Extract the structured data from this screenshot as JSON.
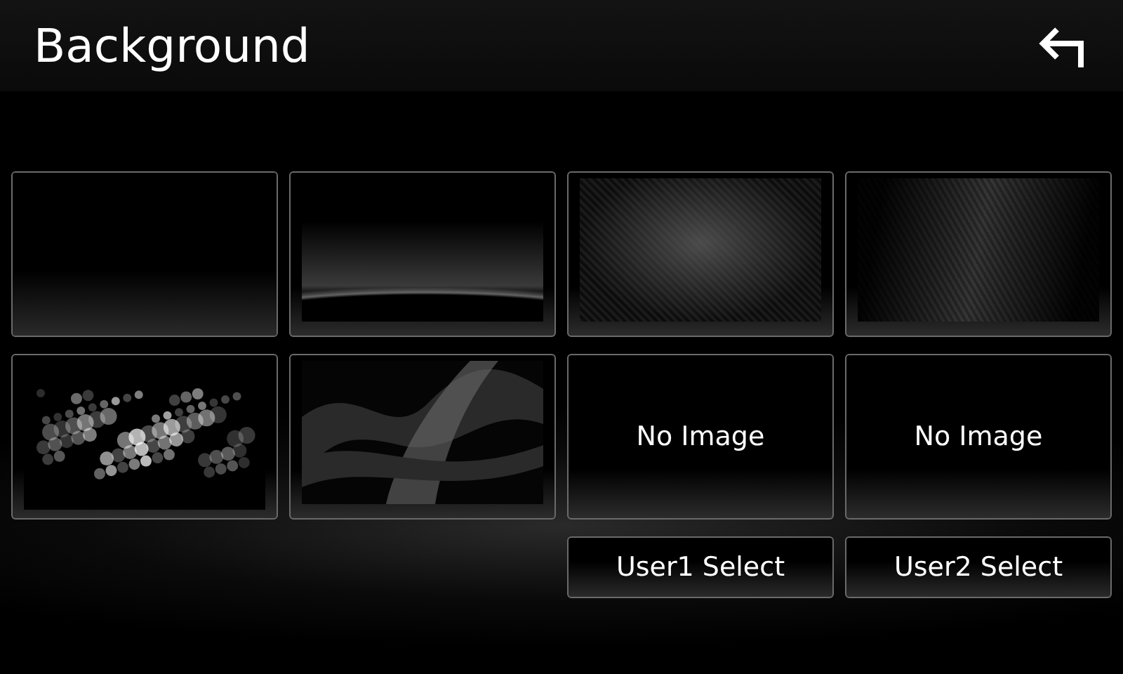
{
  "header": {
    "title": "Background"
  },
  "tiles": [
    {
      "kind": "plain"
    },
    {
      "kind": "horizon"
    },
    {
      "kind": "carbon"
    },
    {
      "kind": "mesh"
    },
    {
      "kind": "bokeh"
    },
    {
      "kind": "swirl"
    },
    {
      "kind": "empty",
      "label": "No Image"
    },
    {
      "kind": "empty",
      "label": "No Image"
    }
  ],
  "buttons": [
    "User1 Select",
    "User2 Select"
  ]
}
